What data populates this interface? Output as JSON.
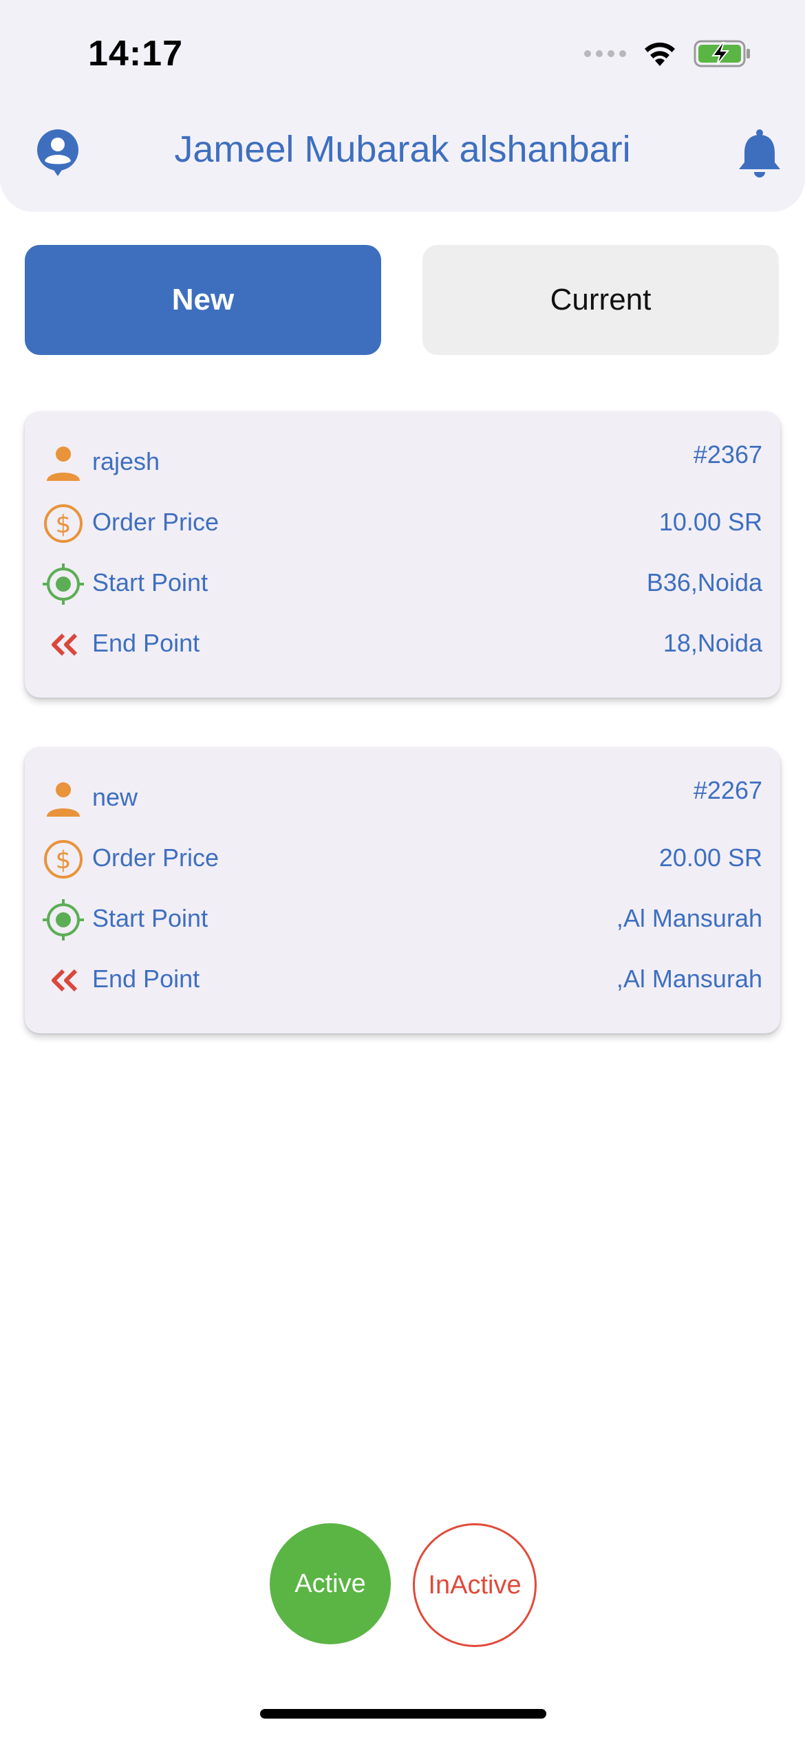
{
  "status_bar": {
    "time": "14:17",
    "icons": [
      "signal-dots-icon",
      "wifi-icon",
      "battery-charging-icon"
    ]
  },
  "header": {
    "title": "Jameel Mubarak alshanbari",
    "left_icon": "profile-icon",
    "right_icon": "bell-icon"
  },
  "tabs": [
    {
      "label": "New",
      "selected": true
    },
    {
      "label": "Current",
      "selected": false
    }
  ],
  "orders": [
    {
      "customer": "rajesh",
      "order_id": "#2367",
      "price_label": "Order Price",
      "price": "10.00 SR",
      "start_label": "Start Point",
      "start": "B36,Noida",
      "end_label": "End Point",
      "end": "18,Noida"
    },
    {
      "customer": "new",
      "order_id": "#2267",
      "price_label": "Order Price",
      "price": "20.00 SR",
      "start_label": "Start Point",
      "start": ",Al Mansurah",
      "end_label": "End Point",
      "end": ",Al Mansurah"
    }
  ],
  "status_buttons": {
    "active_label": "Active",
    "inactive_label": "InActive"
  },
  "colors": {
    "primary_blue": "#3e6fbf",
    "header_bg": "#f3f1f8",
    "card_bg": "#f1eef6",
    "orange_icon": "#e9933b",
    "green_icon": "#5cae55",
    "red_icon": "#d9483b",
    "active_green": "#5ab544",
    "inactive_red": "#e04a3a"
  }
}
